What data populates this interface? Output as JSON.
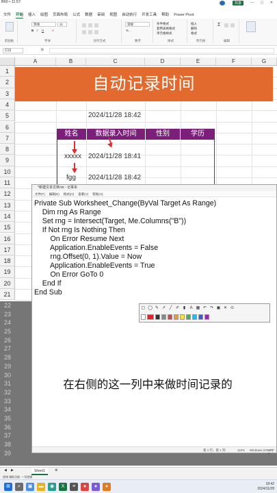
{
  "titlebar": {
    "text": "B60 • 11:57",
    "share_label": "共享"
  },
  "ribbon_tabs": [
    "文件",
    "开始",
    "插入",
    "绘图",
    "页面布局",
    "公式",
    "数据",
    "审阅",
    "视图",
    "自动执行",
    "开发工具",
    "帮助",
    "Power Pivot"
  ],
  "ribbon": {
    "font_name": "等线",
    "font_size": "11",
    "number_format": "常规",
    "groups": [
      "剪贴板",
      "字体",
      "对齐方式",
      "数字",
      "样式",
      "单元格",
      "编辑"
    ],
    "cond_format": "条件格式",
    "table_format": "套用表格格式",
    "cell_style": "单元格样式",
    "insert": "插入",
    "delete": "删除",
    "format": "格式"
  },
  "formula_bar": {
    "name_box": "C13",
    "fx": "fx"
  },
  "columns": [
    "A",
    "B",
    "C",
    "D",
    "E",
    "F",
    "G"
  ],
  "rows": [
    "1",
    "2",
    "3",
    "4",
    "5",
    "6",
    "7",
    "8",
    "9",
    "10",
    "11",
    "12",
    "13",
    "14",
    "15",
    "16",
    "17",
    "18",
    "19",
    "20",
    "21"
  ],
  "shaded_rows": [
    "22",
    "23",
    "24",
    "25",
    "26",
    "27",
    "28",
    "29",
    "30",
    "31",
    "32",
    "33",
    "34",
    "35",
    "36",
    "37",
    "38",
    "39"
  ],
  "sheet": {
    "banner": "自动记录时间",
    "c3": "2024/11/28 18:42",
    "headers": [
      "姓名",
      "数据录入时间",
      "性别",
      "学历"
    ],
    "r7_b": "xxxxx",
    "r7_c": "2024/11/28 18:41",
    "r9_b": "fgg",
    "r9_c": "2024/11/28 18:42"
  },
  "notepad": {
    "title": "*新建文本文档.txt - 记事本",
    "menu": [
      "文件(F)",
      "编辑(E)",
      "格式(O)",
      "查看(V)",
      "帮助(H)"
    ],
    "code": [
      "Private Sub Worksheet_Change(ByVal Target As Range)",
      "    Dim rng As Range",
      "    Set rng = Intersect(Target, Me.Columns(\"B\"))",
      "    If Not rng Is Nothing Then",
      "        On Error Resume Next",
      "        Application.EnableEvents = False",
      "        rng.Offset(0, 1).Value = Now",
      "        Application.EnableEvents = True",
      "        On Error GoTo 0",
      "    End If",
      "End Sub"
    ],
    "status": {
      "pos": "第 1 行，第 1 列",
      "zoom": "110%",
      "eol": "Windows (CRLF)",
      "enc": "UTF-8"
    }
  },
  "subtitle": "在右侧的这一列中来做时间记录的",
  "sheet_tab": "Sheet1",
  "status_left": "就绪  辅助功能: 一切就绪",
  "tray": {
    "time": "18:42",
    "date": "2024/11/28"
  },
  "colors": {
    "banner": "#e26a2f",
    "header": "#7b1f7b",
    "accent": "#1a7343",
    "arrow": "#d63030"
  },
  "snip_colors": [
    "#ffffff",
    "#e0242a",
    "#333333",
    "#8a8a8a",
    "#c0504d",
    "#f09a2e",
    "#f5e23b",
    "#4caf50",
    "#29b6f6",
    "#3a5bd9",
    "#9c27b0"
  ]
}
